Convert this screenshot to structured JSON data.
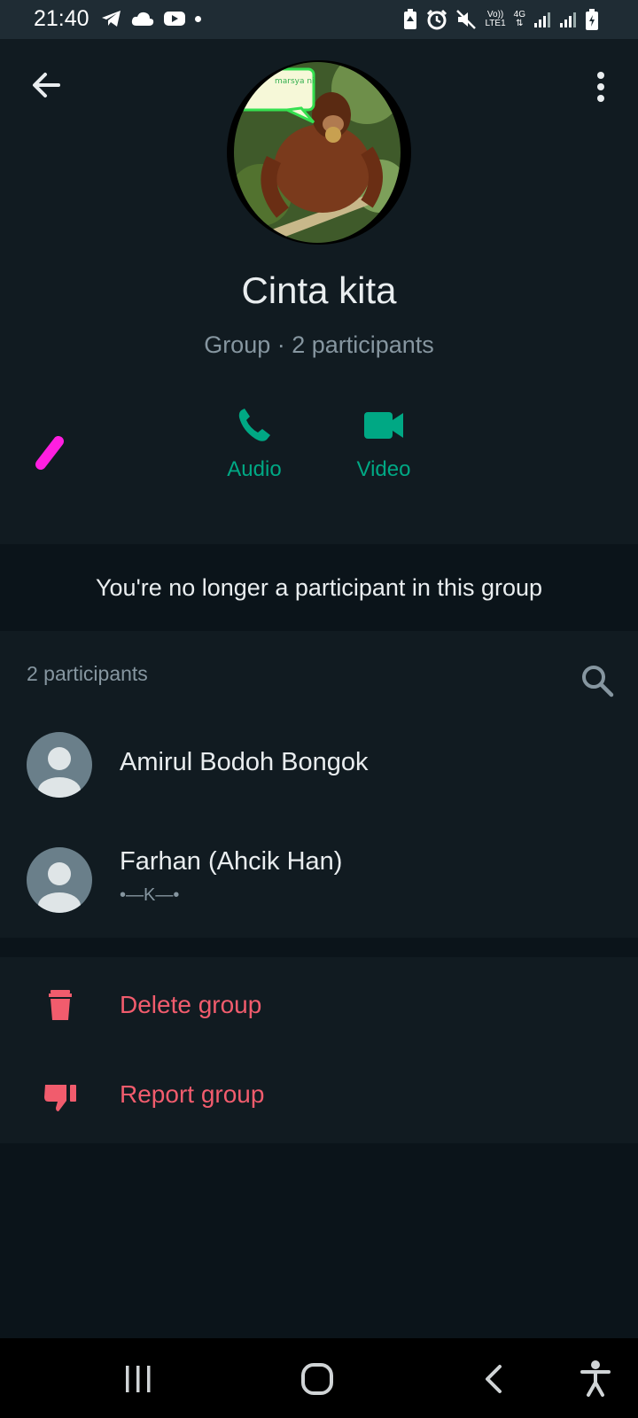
{
  "status_bar": {
    "time": "21:40",
    "left_icons": [
      "telegram-icon",
      "cloud-icon",
      "youtube-icon",
      "dot-icon"
    ],
    "right_icons": [
      "battery-saver-icon",
      "alarm-icon",
      "mute-icon",
      "volte-icon",
      "4g-icon",
      "signal-icon",
      "signal-icon",
      "battery-icon"
    ],
    "volte_label_top": "Vo))",
    "volte_label_bottom": "LTE1",
    "network_label": "4G"
  },
  "header": {
    "group_name": "Cinta kita",
    "subtitle": "Group · 2 participants",
    "avatar_sticker_text": "marsya ni"
  },
  "actions": [
    {
      "label": "Audio",
      "icon": "phone-icon"
    },
    {
      "label": "Video",
      "icon": "video-icon"
    }
  ],
  "banner": {
    "text": "You're no longer a participant in this group"
  },
  "participants": {
    "count_label": "2 participants",
    "items": [
      {
        "name": "Amirul Bodoh Bongok",
        "status": ""
      },
      {
        "name": "Farhan (Ahcik Han)",
        "status": "•—K—•"
      }
    ]
  },
  "danger_actions": [
    {
      "label": "Delete group",
      "icon": "trash-icon"
    },
    {
      "label": "Report group",
      "icon": "thumbs-down-icon"
    }
  ],
  "colors": {
    "accent": "#00a884",
    "danger": "#f15c6d",
    "background": "#111b21",
    "secondary_text": "#8696a0"
  }
}
